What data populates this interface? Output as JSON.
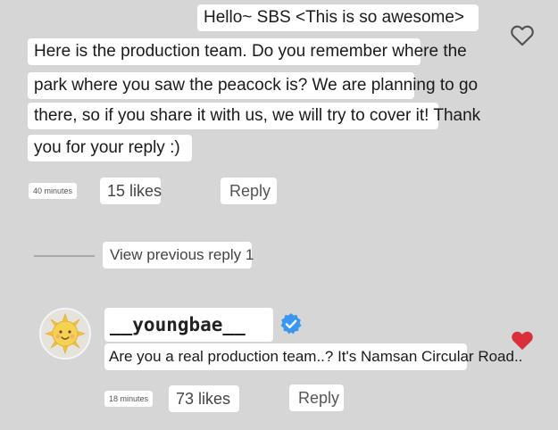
{
  "comment": {
    "lines": [
      "Hello~ SBS <This is so awesome>",
      "Here is the production team. Do you remember where the",
      "park where you saw the peacock is? We are planning to go",
      "there, so if you share it with us, we will try to cover it! Thank",
      "you for your reply :)"
    ],
    "time": "40 minutes",
    "likes": "15 likes",
    "reply_label": "Reply"
  },
  "view_previous": "View previous reply 1",
  "reply": {
    "username": "__youngbae__",
    "verified": true,
    "text": "Are you a real production team..? It's Namsan Circular Road..",
    "time": "18 minutes",
    "likes": "73 likes",
    "reply_label": "Reply",
    "liked": true
  },
  "colors": {
    "background": "#d6d6d6",
    "heart_liked": "#d9303b",
    "verified_badge": "#3897f0"
  },
  "icons": {
    "like_outline": "heart-outline-icon",
    "like_filled": "heart-filled-icon",
    "verified": "verified-badge-icon"
  }
}
